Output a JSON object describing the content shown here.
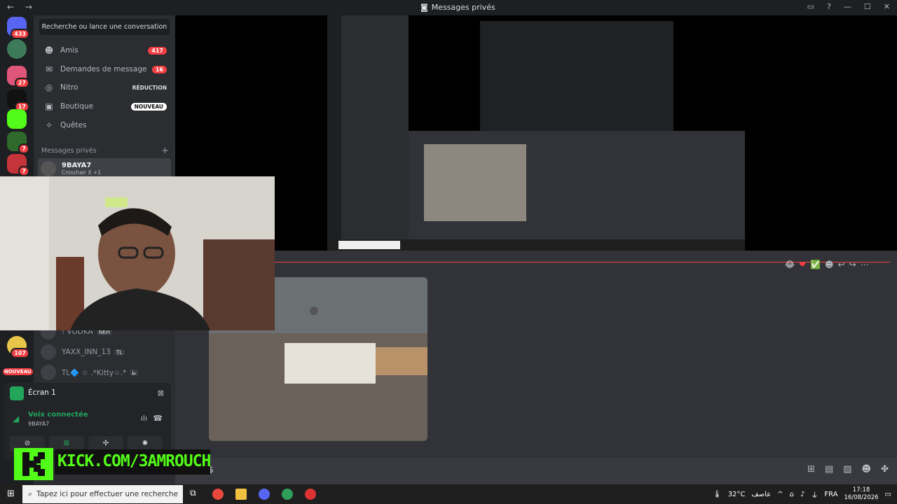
{
  "window": {
    "title": "Messages privés",
    "nav_arrows": "← →",
    "controls": [
      "▭",
      "?",
      "—",
      "☐",
      "✕"
    ]
  },
  "servers": {
    "badges": [
      "433",
      "27",
      "17",
      "7",
      "7",
      "107"
    ],
    "new_label": "NOUVEAU"
  },
  "sidebar": {
    "search_label": "Recherche ou lance une conversation",
    "items": [
      {
        "label": "Amis",
        "icon": "friends-icon",
        "badge": "417"
      },
      {
        "label": "Demandes de message",
        "icon": "mail-icon",
        "badge": "16"
      },
      {
        "label": "Nitro",
        "icon": "nitro-icon",
        "tag": "RÉDUCTION"
      },
      {
        "label": "Boutique",
        "icon": "shop-icon",
        "tag": "NOUVEAU"
      },
      {
        "label": "Quêtes",
        "icon": "quests-icon"
      }
    ],
    "dm_header": "Messages privés",
    "dm_plus": "+",
    "dms": [
      {
        "name": "9BAYA7",
        "status": "Crosshair X +1"
      },
      {
        "name": "! VODKA",
        "tag": "NKH"
      },
      {
        "name": "YAXX_INN_13",
        "tag": "TL"
      },
      {
        "name": "TL🔷 ☆ .*Kitty☆.*",
        "tag": "ﻃ"
      }
    ]
  },
  "voice": {
    "screen_title": "Écran 1",
    "status": "Voix connectée",
    "user": "9BAYA7"
  },
  "message": {
    "reactions": [
      "😂",
      "❤",
      "✅",
      "☻",
      "↩",
      "↪",
      "⋯"
    ]
  },
  "chat": {
    "input_text": "$"
  },
  "overlay": {
    "kick_url": "KICK.COM/3AMROUCH"
  },
  "taskbar": {
    "search_placeholder": "Tapez ici pour effectuer une recherche",
    "weather": "32°C",
    "weather_desc": "عاصف",
    "lang": "FRA",
    "time": "17:18",
    "date": "16/08/2026"
  },
  "colors": {
    "discord_bg": "#313338",
    "sidebar_bg": "#2b2d31",
    "red": "#f23f43",
    "green": "#23a55a",
    "kick_green": "#53fc18"
  }
}
